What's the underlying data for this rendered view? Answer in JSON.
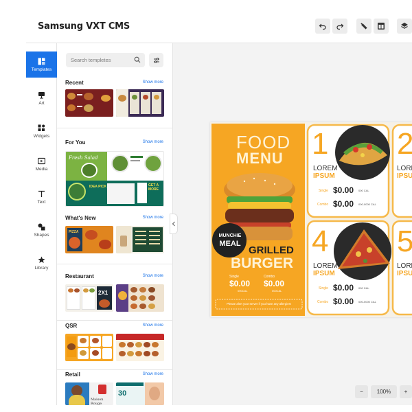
{
  "app": {
    "title": "Samsung VXT CMS"
  },
  "toolbar": {
    "undo_icon": "undo-icon",
    "redo_icon": "redo-icon",
    "magic_icon": "magic-wand-icon",
    "layout_icon": "layout-icon",
    "layers_icon": "layers-icon"
  },
  "rail": {
    "items": [
      {
        "label": "Templates",
        "icon": "templates-icon",
        "active": true
      },
      {
        "label": "Art",
        "icon": "art-icon"
      },
      {
        "label": "Widgets",
        "icon": "widgets-icon"
      },
      {
        "label": "Media",
        "icon": "media-icon"
      },
      {
        "label": "Text",
        "icon": "text-icon"
      },
      {
        "label": "Shapes",
        "icon": "shapes-icon"
      },
      {
        "label": "Library",
        "icon": "library-icon"
      }
    ]
  },
  "panel": {
    "search_placeholder": "Search templetes",
    "show_more": "Show more",
    "sections": [
      {
        "title": "Recent"
      },
      {
        "title": "For You"
      },
      {
        "title": "What's New"
      },
      {
        "title": "Restaurant"
      },
      {
        "title": "QSR"
      },
      {
        "title": "Retail"
      }
    ],
    "thumb_text": {
      "salad": "Fresh Salad",
      "idea_pick": "IDEA PICK",
      "get_more": "GET A MORE",
      "pizza": "PIZZA",
      "two_for_one": "2X1",
      "retail_30": "30",
      "retail_brand": "Maison Rouge"
    }
  },
  "canvas": {
    "food": "FOOD",
    "menu": "MENU",
    "badge_line1": "MUNCHIE",
    "badge_line2": "MEAL",
    "grilled": "GRILLED",
    "burger": "BURGER",
    "single_label": "Single",
    "combo_label": "Combo",
    "price": "$0.00",
    "cal_label": "000CAL",
    "allergy_note": "Please alert your server if you have any allergies!",
    "items": [
      {
        "number": "1",
        "name1": "LOREM",
        "name2": "IPSUM",
        "single_price": "$0.00",
        "single_cal": "000 CAL",
        "combo_price": "$0.00",
        "combo_cal": "000-0000 CAL"
      },
      {
        "number": "4",
        "name1": "LOREM",
        "name2": "IPSUM",
        "single_price": "$0.00",
        "single_cal": "000 CAL",
        "combo_price": "$0.00",
        "combo_cal": "000-0000 CAL"
      },
      {
        "number": "2",
        "name1": "LORE",
        "name2": "IPSU"
      },
      {
        "number": "5",
        "name1": "LORE",
        "name2": "IPSU"
      }
    ]
  },
  "zoom": {
    "minus": "−",
    "level": "100%",
    "plus": "+"
  },
  "colors": {
    "accent": "#1a73e8",
    "menu_orange": "#f6a623",
    "card_border": "#f6b94a"
  }
}
